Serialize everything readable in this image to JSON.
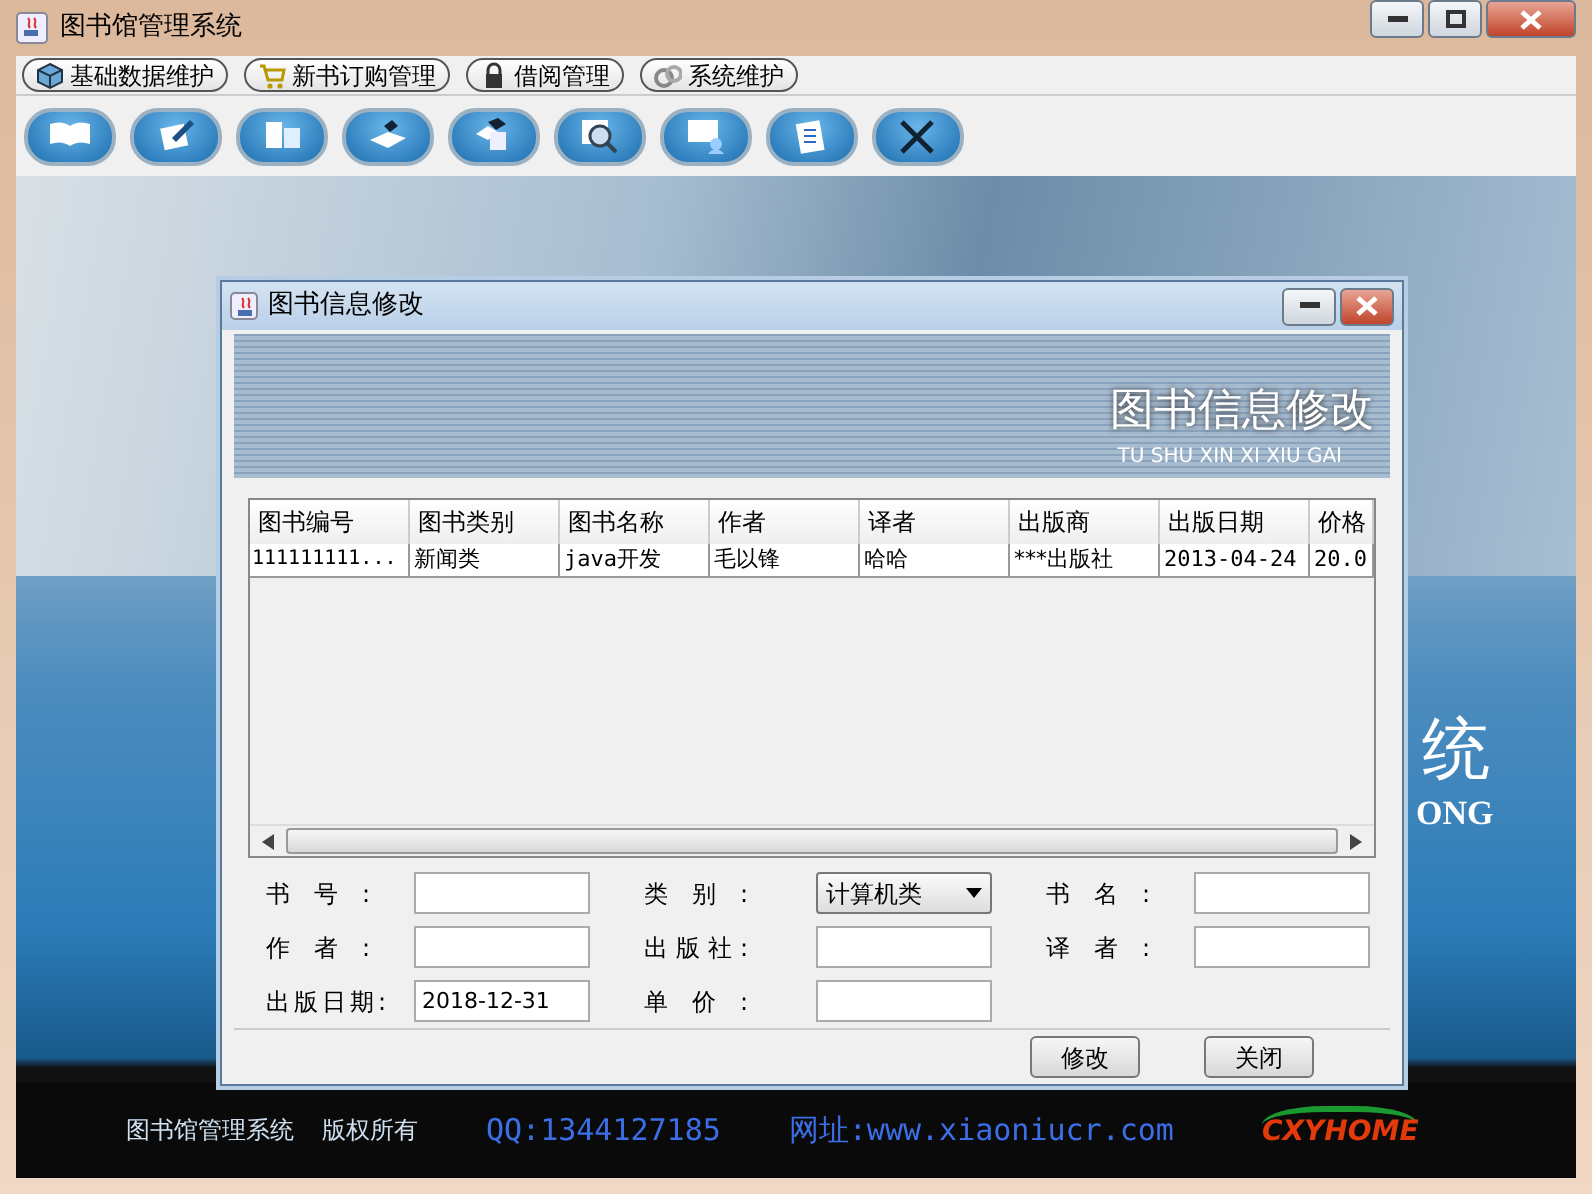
{
  "window": {
    "title": "图书馆管理系统"
  },
  "menu": [
    {
      "label": "基础数据维护"
    },
    {
      "label": "新书订购管理"
    },
    {
      "label": "借阅管理"
    },
    {
      "label": "系统维护"
    }
  ],
  "background": {
    "text_1": "统",
    "text_2": "ONG"
  },
  "footer": {
    "name": "图书馆管理系统",
    "rights": "版权所有",
    "qq": "QQ:1344127185",
    "site": "网址:www.xiaoniucr.com",
    "logo": "CXYHOME"
  },
  "dialog": {
    "title": "图书信息修改",
    "banner_title": "图书信息修改",
    "banner_subtitle": "TU SHU XIN XI XIU GAI",
    "table": {
      "columns": [
        "图书编号",
        "图书类别",
        "图书名称",
        "作者",
        "译者",
        "出版商",
        "出版日期",
        "价格"
      ],
      "rows": [
        {
          "selected": false,
          "cells": [
            "111111111...",
            "新闻类",
            "java开发",
            "毛以锋",
            "哈哈",
            "***出版社",
            "2013-04-24",
            "20.0"
          ]
        }
      ]
    },
    "fields": [
      {
        "label": "书号:",
        "kind": "text"
      },
      {
        "label": "类别:",
        "kind": "select",
        "value": "计算机类"
      },
      {
        "label": "书名:",
        "kind": "text"
      },
      {
        "label": "作者:",
        "kind": "text"
      },
      {
        "label": "出版社:",
        "kind": "text"
      },
      {
        "label": "译者:",
        "kind": "text"
      },
      {
        "label": "出版日期:",
        "kind": "text",
        "value": "2018-12-31"
      },
      {
        "label": "单价:",
        "kind": "text"
      }
    ],
    "buttons": [
      "修改",
      "关闭"
    ]
  }
}
